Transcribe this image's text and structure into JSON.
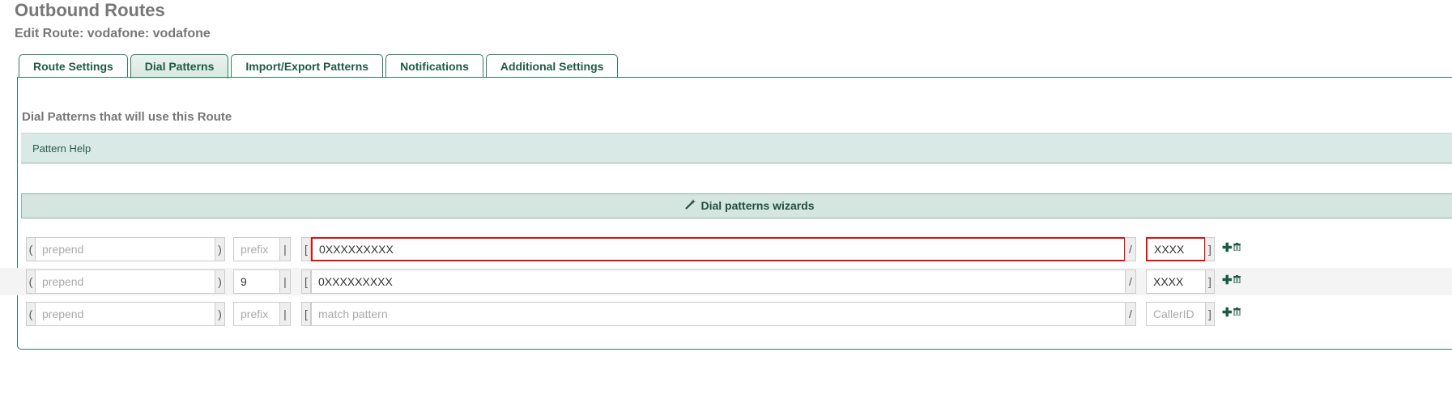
{
  "header": {
    "title": "Outbound Routes",
    "subtitle": "Edit Route: vodafone: vodafone"
  },
  "tabs": [
    {
      "label": "Route Settings",
      "active": false
    },
    {
      "label": "Dial Patterns",
      "active": true
    },
    {
      "label": "Import/Export Patterns",
      "active": false
    },
    {
      "label": "Notifications",
      "active": false
    },
    {
      "label": "Additional Settings",
      "active": false
    }
  ],
  "section": {
    "title": "Dial Patterns that will use this Route",
    "help_label": "Pattern Help",
    "wizard_label": "Dial patterns wizards",
    "wizard_icon": "magic-wand-icon"
  },
  "symbols": {
    "open_paren": "(",
    "close_paren": ")",
    "pipe": "|",
    "open_bracket": "[",
    "slash": "/",
    "close_bracket": "]",
    "add_icon": "plus-icon",
    "delete_icon": "trash-icon"
  },
  "rows": [
    {
      "prepend": {
        "value": "",
        "placeholder": "prepend"
      },
      "prefix": {
        "value": "",
        "placeholder": "prefix"
      },
      "match": {
        "value": "0XXXXXXXXX",
        "placeholder": "match pattern",
        "highlighted": true
      },
      "callerid": {
        "value": "XXXX",
        "placeholder": "CallerID",
        "highlighted": true
      }
    },
    {
      "prepend": {
        "value": "",
        "placeholder": "prepend"
      },
      "prefix": {
        "value": "9",
        "placeholder": "prefix"
      },
      "match": {
        "value": "0XXXXXXXXX",
        "placeholder": "match pattern",
        "highlighted": false
      },
      "callerid": {
        "value": "XXXX",
        "placeholder": "CallerID",
        "highlighted": false
      }
    },
    {
      "prepend": {
        "value": "",
        "placeholder": "prepend"
      },
      "prefix": {
        "value": "",
        "placeholder": "prefix"
      },
      "match": {
        "value": "",
        "placeholder": "match pattern",
        "highlighted": false
      },
      "callerid": {
        "value": "",
        "placeholder": "CallerID",
        "highlighted": false
      }
    }
  ],
  "colors": {
    "accent": "#2e7d5e",
    "highlight": "#e01010",
    "help_bg": "#d9e9e6",
    "wizard_bg": "#d5e6e0"
  }
}
